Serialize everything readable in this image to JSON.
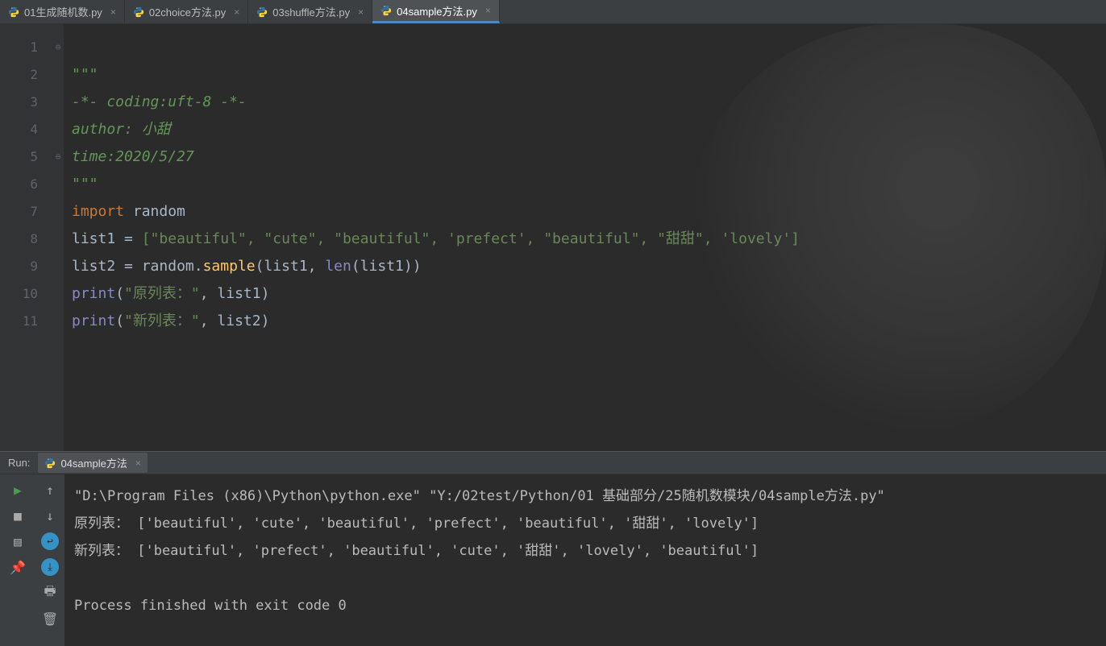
{
  "tabs": [
    {
      "label": "01生成随机数.py",
      "active": false
    },
    {
      "label": "02choice方法.py",
      "active": false
    },
    {
      "label": "03shuffle方法.py",
      "active": false
    },
    {
      "label": "04sample方法.py",
      "active": true
    }
  ],
  "gutter": [
    "1",
    "2",
    "3",
    "4",
    "5",
    "6",
    "7",
    "8",
    "9",
    "10",
    "11"
  ],
  "code": {
    "l1": "\"\"\"",
    "l2": "-*- coding:uft-8 -*-",
    "l3": "author: 小甜",
    "l4": "time:2020/5/27",
    "l5": "\"\"\"",
    "l6_kw": "import",
    "l6_mod": "random",
    "l7_var": "list1",
    "l7_list": "[\"beautiful\", \"cute\", \"beautiful\", 'prefect', \"beautiful\", \"甜甜\", 'lovely']",
    "l8_var": "list2",
    "l8_mod": "random",
    "l8_fn": "sample",
    "l8_arg1": "list1",
    "l8_len": "len",
    "l8_arg2": "list1",
    "l9_fn": "print",
    "l9_str": "\"原列表：\"",
    "l9_arg": "list1",
    "l10_fn": "print",
    "l10_str": "\"新列表：\"",
    "l10_arg": "list2"
  },
  "run": {
    "label": "Run:",
    "tab": "04sample方法",
    "out1": "\"D:\\Program Files (x86)\\Python\\python.exe\" \"Y:/02test/Python/01 基础部分/25随机数模块/04sample方法.py\"",
    "out2": "原列表： ['beautiful', 'cute', 'beautiful', 'prefect', 'beautiful', '甜甜', 'lovely']",
    "out3": "新列表： ['beautiful', 'prefect', 'beautiful', 'cute', '甜甜', 'lovely', 'beautiful']",
    "out4": "",
    "out5": "Process finished with exit code 0"
  }
}
